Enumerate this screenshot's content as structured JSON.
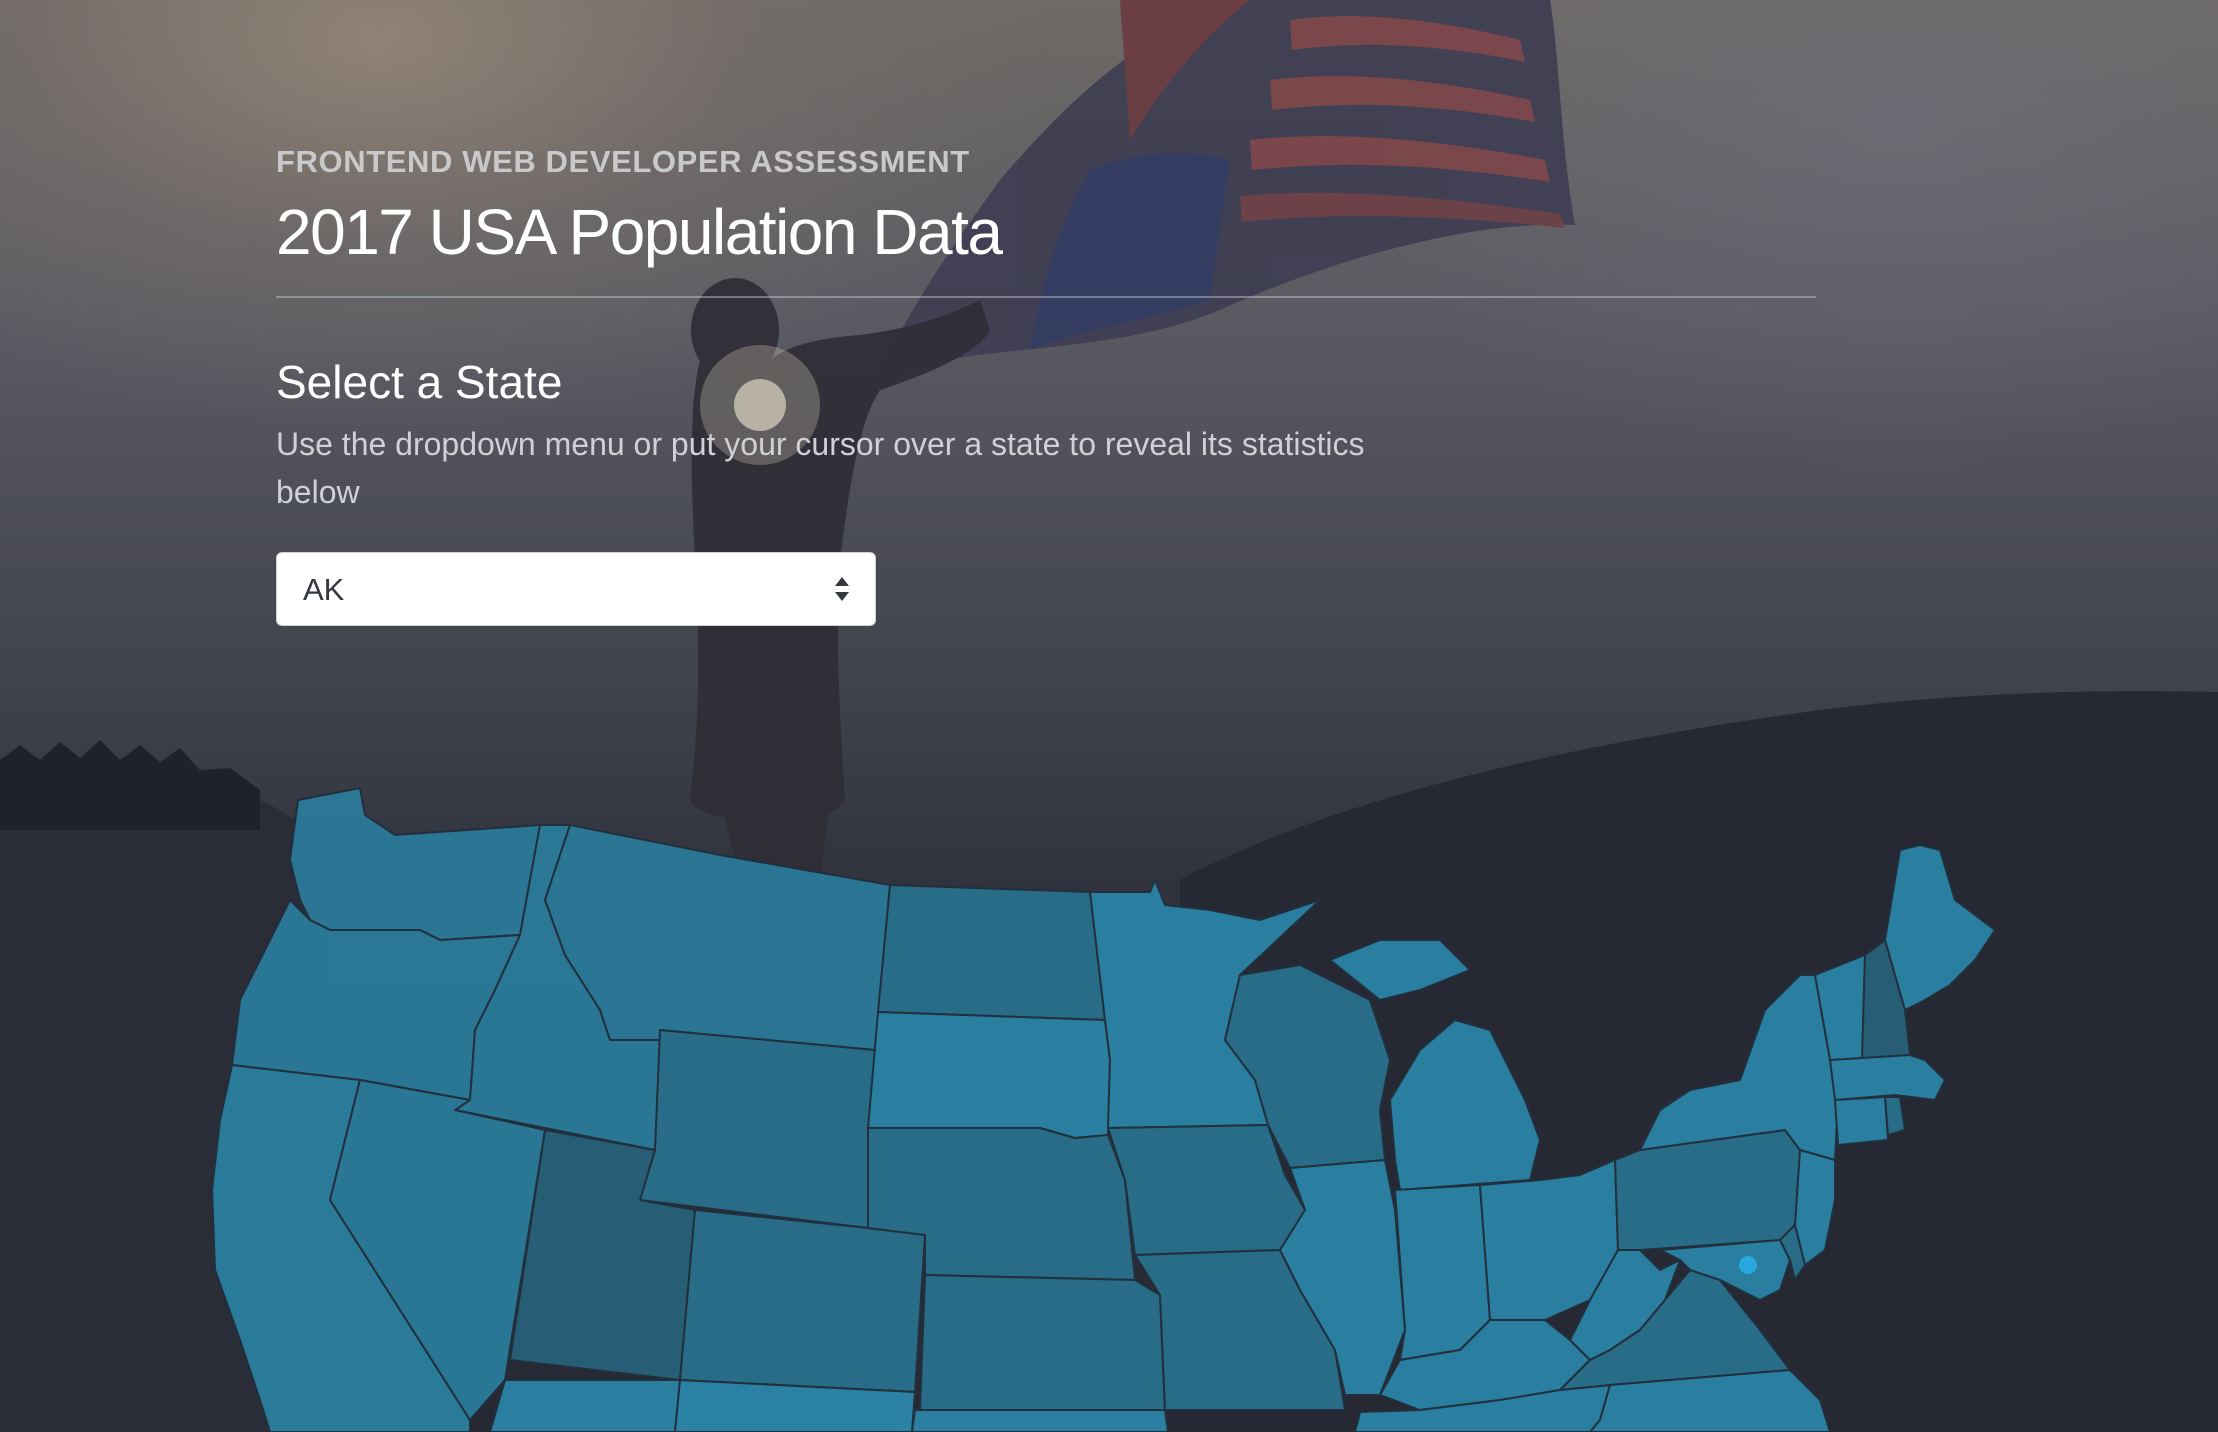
{
  "header": {
    "eyebrow": "FRONTEND WEB DEVELOPER ASSESSMENT",
    "title": "2017 USA Population Data"
  },
  "selector": {
    "title": "Select a State",
    "description": "Use the dropdown menu or put your cursor over a state to reveal its statistics below",
    "selected": "AK"
  },
  "map": {
    "fill_colors": {
      "light": "#2a7fa0",
      "medium": "#286c88",
      "dark": "#275d75",
      "overlay": "#2a81a3"
    },
    "marker_color": "#29a8df"
  }
}
